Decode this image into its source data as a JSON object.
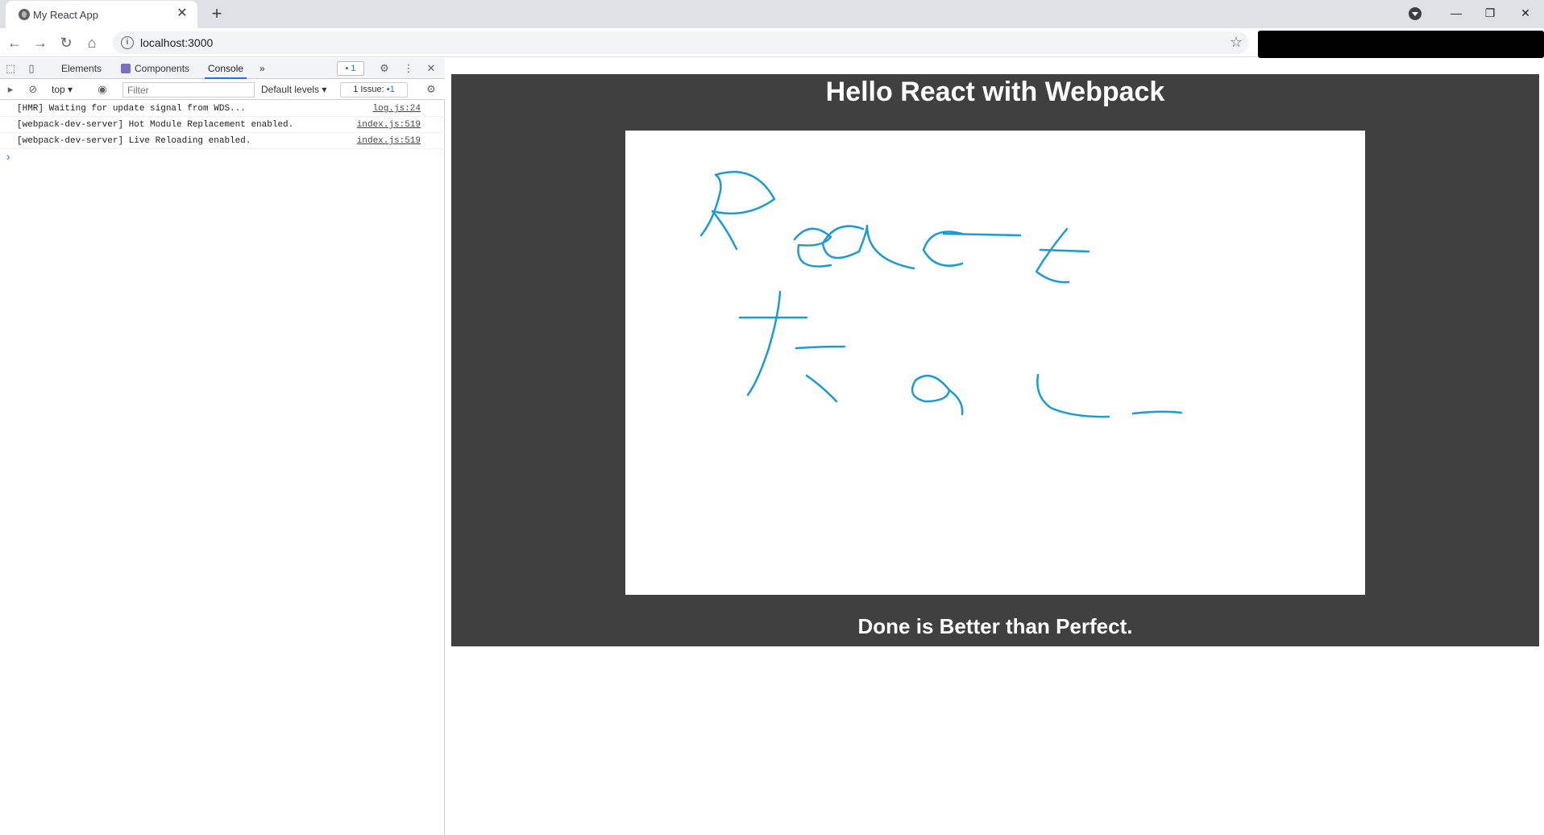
{
  "browser": {
    "tab_title": "My React App",
    "tab_close": "✕",
    "new_tab": "+",
    "window_controls": {
      "minimize": "—",
      "maximize": "❐",
      "close": "✕"
    },
    "url": "localhost:3000"
  },
  "devtools": {
    "tabs": [
      {
        "label": "Elements"
      },
      {
        "label": "Components"
      },
      {
        "label": "Console"
      }
    ],
    "more_tabs": "»",
    "messages_badge": "1",
    "context": "top",
    "filter_placeholder": "Filter",
    "levels": "Default levels",
    "issues_label": "1 Issue:",
    "issues_count": "1",
    "console_rows": [
      {
        "text": "[HMR] Waiting for update signal from WDS...",
        "source": "log.js:24"
      },
      {
        "text": "[webpack-dev-server] Hot Module Replacement enabled.",
        "source": "index.js:519"
      },
      {
        "text": "[webpack-dev-server] Live Reloading enabled.",
        "source": "index.js:519"
      }
    ],
    "prompt": "›"
  },
  "page": {
    "title": "Hello React with Webpack",
    "footer": "Done is Better than Perfect.",
    "stroke_color": "#1a9ad6",
    "background_color": "#404040"
  }
}
